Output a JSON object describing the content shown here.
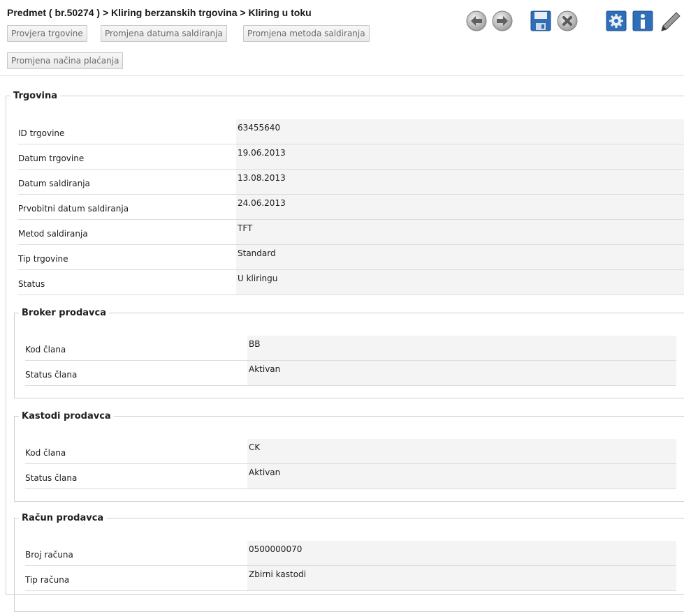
{
  "header": {
    "breadcrumb": "Predmet ( br.50274 ) > Kliring berzanskih trgovina > Kliring u toku"
  },
  "actions": {
    "provjera": "Provjera trgovine",
    "promjena_datuma": "Promjena datuma saldiranja",
    "promjena_metoda": "Promjena metoda saldiranja",
    "promjena_nacina": "Promjena načina plaćanja"
  },
  "toolbar": {
    "icons": [
      "back-arrow-icon",
      "forward-arrow-icon",
      "save-icon",
      "cancel-icon",
      "settings-icon",
      "info-icon",
      "edit-pencil-icon"
    ],
    "accent": "#2f6fb8"
  },
  "trgovina": {
    "legend": "Trgovina",
    "rows": [
      {
        "label": "ID trgovine",
        "value": "63455640"
      },
      {
        "label": "Datum trgovine",
        "value": "19.06.2013"
      },
      {
        "label": "Datum saldiranja",
        "value": "13.08.2013"
      },
      {
        "label": "Prvobitni datum saldiranja",
        "value": "24.06.2013"
      },
      {
        "label": "Metod saldiranja",
        "value": "TFT"
      },
      {
        "label": "Tip trgovine",
        "value": "Standard"
      },
      {
        "label": "Status",
        "value": "U kliringu"
      }
    ]
  },
  "broker": {
    "legend": "Broker prodavca",
    "rows": [
      {
        "label": "Kod člana",
        "value": "BB"
      },
      {
        "label": "Status člana",
        "value": "Aktivan"
      }
    ]
  },
  "kastodi": {
    "legend": "Kastodi prodavca",
    "rows": [
      {
        "label": "Kod člana",
        "value": "CK"
      },
      {
        "label": "Status člana",
        "value": "Aktivan"
      }
    ]
  },
  "racun": {
    "legend": "Račun prodavca",
    "rows": [
      {
        "label": "Broj računa",
        "value": "0500000070"
      },
      {
        "label": "Tip računa",
        "value": "Zbirni kastodi"
      }
    ]
  }
}
